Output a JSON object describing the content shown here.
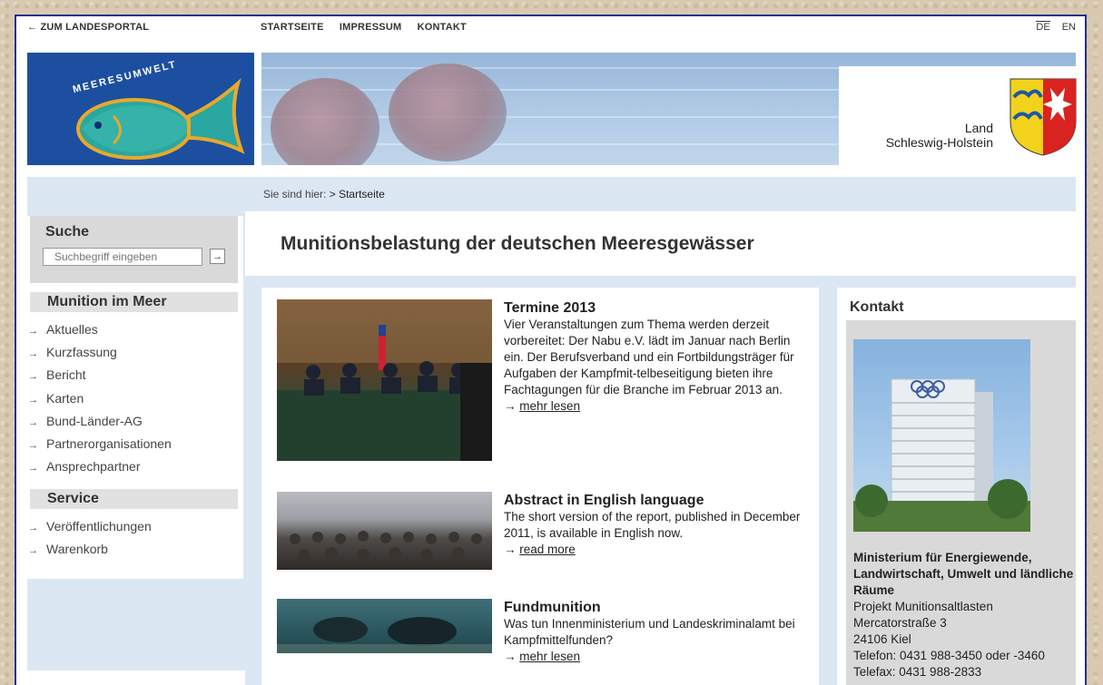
{
  "header": {
    "back_link": "← ZUM LANDESPORTAL",
    "nav": [
      "STARTSEITE",
      "IMPRESSUM",
      "KONTAKT"
    ],
    "languages": [
      "DE",
      "EN"
    ],
    "logo_text": "MEERESUMWELT",
    "land_label": "Land",
    "land_name": "Schleswig-Holstein"
  },
  "breadcrumb": {
    "prefix": "Sie sind hier:",
    "current": "Startseite",
    "separator": ">"
  },
  "search": {
    "title": "Suche",
    "placeholder": "Suchbegriff eingeben",
    "button": "→"
  },
  "sidebar": {
    "section1_title": "Munition im Meer",
    "section1_items": [
      "Aktuelles",
      "Kurzfassung",
      "Bericht",
      "Karten",
      "Bund-Länder-AG",
      "Partnerorganisationen",
      "Ansprechpartner"
    ],
    "section2_title": "Service",
    "section2_items": [
      "Veröffentlichungen",
      "Warenkorb"
    ]
  },
  "page_title": "Munitionsbelastung der deutschen Meeresgewässer",
  "news": [
    {
      "title": "Termine 2013",
      "text": "Vier Veranstaltungen zum Thema werden derzeit vorbereitet: Der Nabu e.V. lädt im Januar nach Berlin ein. Der Berufsverband und ein Fortbildungsträger für Aufgaben der Kampfmit-telbeseitigung bieten ihre Fachtagungen für die Branche im Februar 2013 an.",
      "more": "mehr lesen"
    },
    {
      "title": "Abstract in English language",
      "text": "The short version of the report, published in December 2011, is available in English now.",
      "more": "read more"
    },
    {
      "title": "Fundmunition",
      "text": "Was tun Innenministerium und Landeskriminalamt bei Kampfmittelfunden?",
      "more": "mehr lesen"
    }
  ],
  "contact": {
    "title": "Kontakt",
    "org_bold": "Ministerium für Energiewende, Landwirtschaft, Umwelt und ländliche Räume",
    "project": "Projekt Munitionsaltlasten",
    "street": "Mercatorstraße 3",
    "city": "24106 Kiel",
    "phone": "Telefon: 0431 988-3450 oder -3460",
    "fax": "Telefax: 0431 988-2833"
  },
  "colors": {
    "frame_border": "#1f2f95",
    "logo_bg": "#1d4fa0",
    "panel_blue": "#dbe7f3"
  }
}
